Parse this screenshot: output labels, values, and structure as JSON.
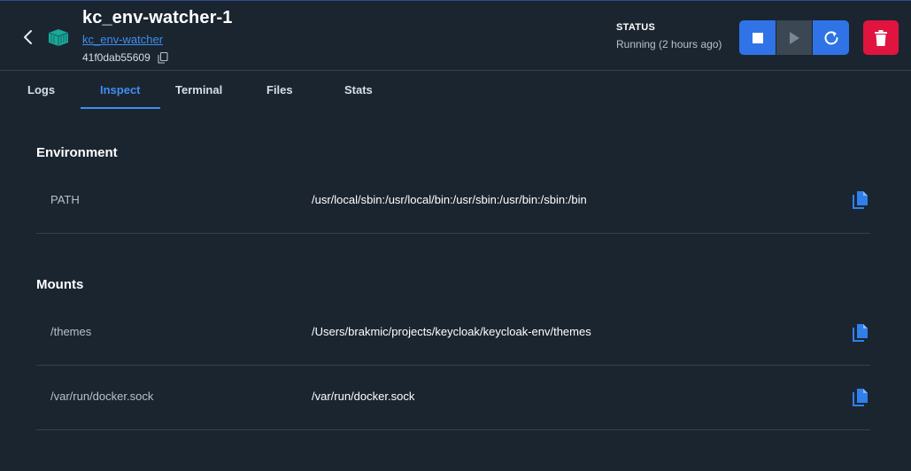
{
  "header": {
    "back_icon": "chevron-left-icon",
    "container_icon": "container-icon",
    "title": "kc_env-watcher-1",
    "image_link": "kc_env-watcher",
    "container_id": "41f0dab55609",
    "copy_icon": "copy-icon",
    "status_label": "STATUS",
    "status_value": "Running (2 hours ago)",
    "actions": [
      "stop-icon",
      "play-icon",
      "restart-icon",
      "trash-icon"
    ],
    "colors": {
      "primary": "#2f73e6",
      "disabled": "#3b4752",
      "danger": "#e0143f",
      "link": "#3d8ef0"
    }
  },
  "tabs": [
    {
      "label": "Logs",
      "active": false
    },
    {
      "label": "Inspect",
      "active": true
    },
    {
      "label": "Terminal",
      "active": false
    },
    {
      "label": "Files",
      "active": false
    },
    {
      "label": "Stats",
      "active": false
    }
  ],
  "environment": {
    "title": "Environment",
    "rows": [
      {
        "key": "PATH",
        "value": "/usr/local/sbin:/usr/local/bin:/usr/sbin:/usr/bin:/sbin:/bin"
      }
    ]
  },
  "mounts": {
    "title": "Mounts",
    "rows": [
      {
        "key": "/themes",
        "value": "/Users/brakmic/projects/keycloak/keycloak-env/themes"
      },
      {
        "key": "/var/run/docker.sock",
        "value": "/var/run/docker.sock"
      }
    ]
  }
}
